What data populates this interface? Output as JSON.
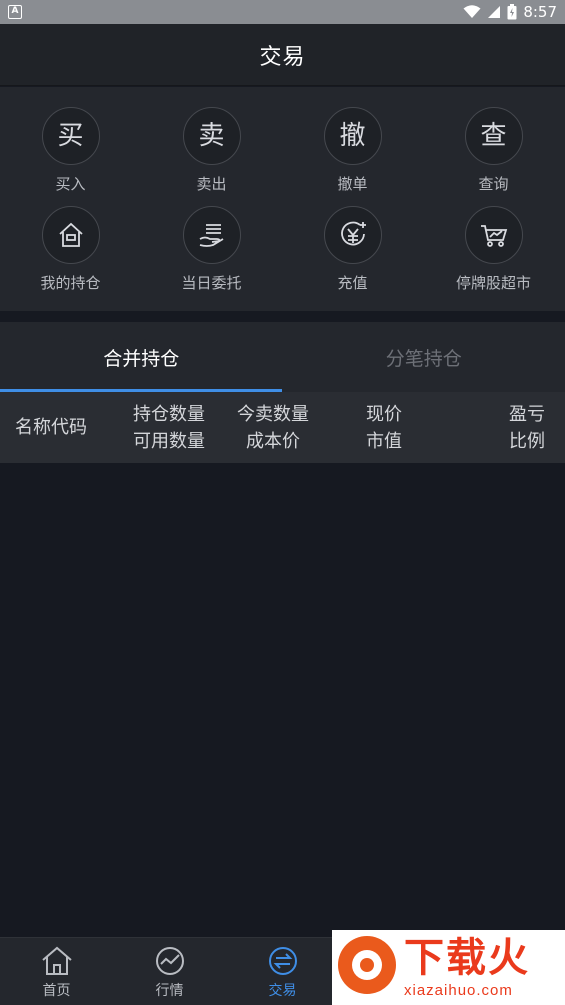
{
  "status_bar": {
    "app_badge": "A",
    "time": "8:57",
    "icons": [
      "wifi-icon",
      "cell-signal-icon",
      "battery-icon"
    ]
  },
  "header": {
    "title": "交易"
  },
  "actions": [
    {
      "glyph": "买",
      "label": "买入"
    },
    {
      "glyph": "卖",
      "label": "卖出"
    },
    {
      "glyph": "撤",
      "label": "撤单"
    },
    {
      "glyph": "查",
      "label": "查询"
    },
    {
      "icon": "house-icon",
      "label": "我的持仓"
    },
    {
      "icon": "hand-list-icon",
      "label": "当日委托"
    },
    {
      "icon": "yuan-coin-icon",
      "label": "充值"
    },
    {
      "icon": "shopping-cart-icon",
      "label": "停牌股超市"
    }
  ],
  "tabs": {
    "merged": "合并持仓",
    "split": "分笔持仓"
  },
  "table_header": {
    "name_code": "名称代码",
    "hold_qty": "持仓数量",
    "avail_qty": "可用数量",
    "today_sell_qty": "今卖数量",
    "cost_price": "成本价",
    "current_price": "现价",
    "market_value": "市值",
    "profit_loss": "盈亏",
    "ratio": "比例"
  },
  "bottom_nav": [
    {
      "label": "首页",
      "icon": "home-icon"
    },
    {
      "label": "行情",
      "icon": "chart-circle-icon"
    },
    {
      "label": "交易",
      "icon": "exchange-icon",
      "active": true
    }
  ],
  "watermark": {
    "title": "下载火",
    "subtitle": "xiazaihuo.com"
  },
  "colors": {
    "accent": "#3f8ee6",
    "background": "#161921",
    "panel": "#24272d"
  }
}
